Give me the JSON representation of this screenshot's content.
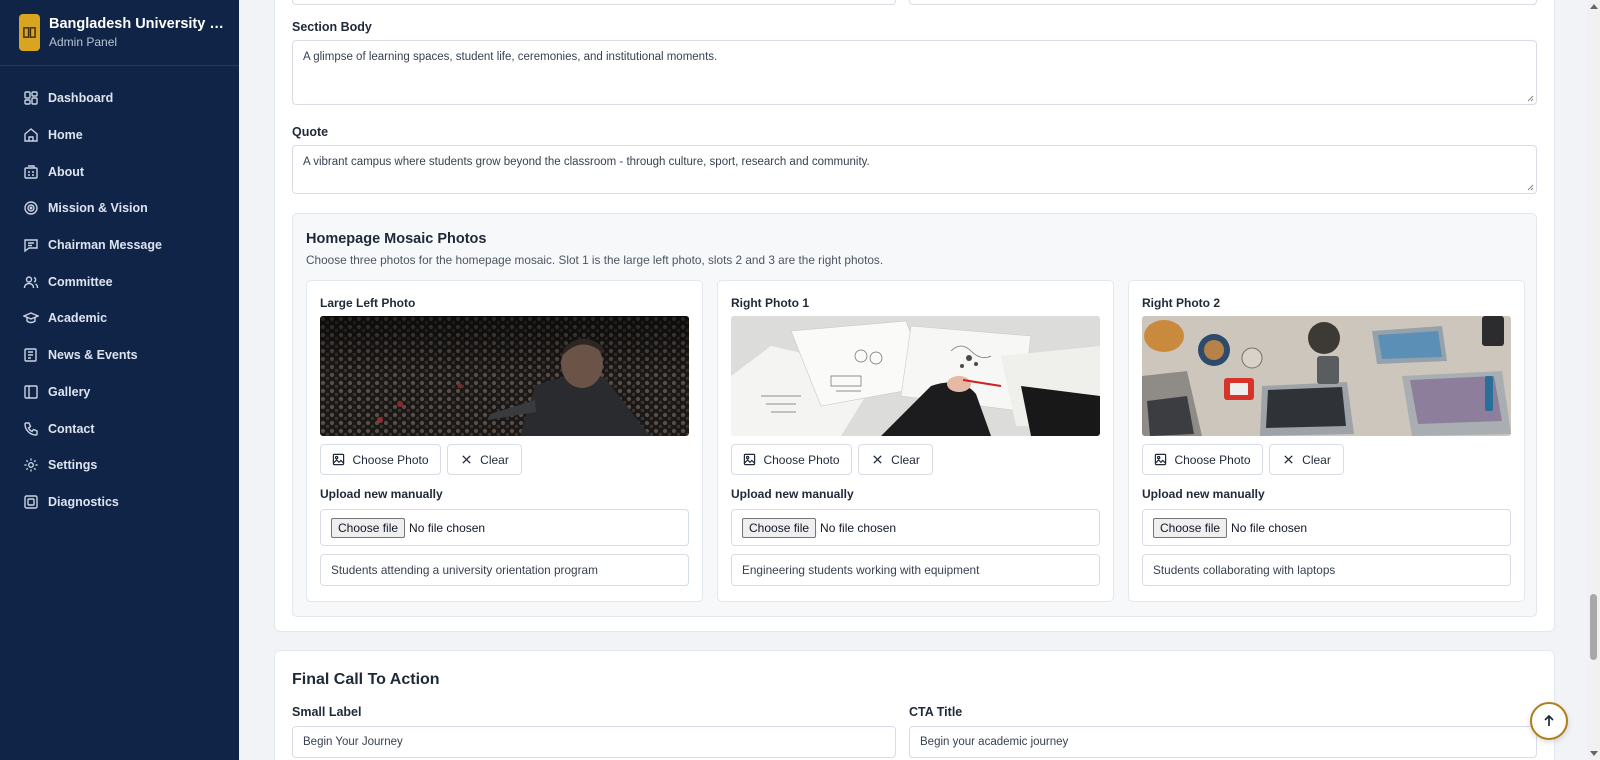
{
  "brand": {
    "title": "Bangladesh University of...",
    "subtitle": "Admin Panel"
  },
  "sidebar": {
    "items": [
      {
        "label": "Dashboard",
        "icon": "dashboard-icon"
      },
      {
        "label": "Home",
        "icon": "home-icon"
      },
      {
        "label": "About",
        "icon": "building-icon"
      },
      {
        "label": "Mission & Vision",
        "icon": "target-icon"
      },
      {
        "label": "Chairman Message",
        "icon": "message-icon"
      },
      {
        "label": "Committee",
        "icon": "users-icon"
      },
      {
        "label": "Academic",
        "icon": "graduation-cap-icon"
      },
      {
        "label": "News & Events",
        "icon": "newspaper-icon"
      },
      {
        "label": "Gallery",
        "icon": "gallery-icon"
      },
      {
        "label": "Contact",
        "icon": "phone-icon"
      },
      {
        "label": "Settings",
        "icon": "gear-icon"
      },
      {
        "label": "Diagnostics",
        "icon": "diagnostics-icon"
      }
    ]
  },
  "section": {
    "body_label": "Section Body",
    "body_value": "A glimpse of learning spaces, student life, ceremonies, and institutional moments.",
    "quote_label": "Quote",
    "quote_value": "A vibrant campus where students grow beyond the classroom - through culture, sport, research and community."
  },
  "mosaic": {
    "title": "Homepage Mosaic Photos",
    "description": "Choose three photos for the homepage mosaic. Slot 1 is the large left photo, slots 2 and 3 are the right photos.",
    "choose_label": "Choose Photo",
    "clear_label": "Clear",
    "upload_label": "Upload new manually",
    "file_button": "Choose file",
    "file_status": "No file chosen",
    "slots": [
      {
        "title": "Large Left Photo",
        "caption": "Students attending a university orientation program"
      },
      {
        "title": "Right Photo 1",
        "caption": "Engineering students working with equipment"
      },
      {
        "title": "Right Photo 2",
        "caption": "Students collaborating with laptops"
      }
    ]
  },
  "cta": {
    "title": "Final Call To Action",
    "small_label_label": "Small Label",
    "small_label_value": "Begin Your Journey",
    "cta_title_label": "CTA Title",
    "cta_title_value": "Begin your academic journey"
  },
  "colors": {
    "sidebar_bg": "#0f2446",
    "accent": "#d9a521"
  }
}
